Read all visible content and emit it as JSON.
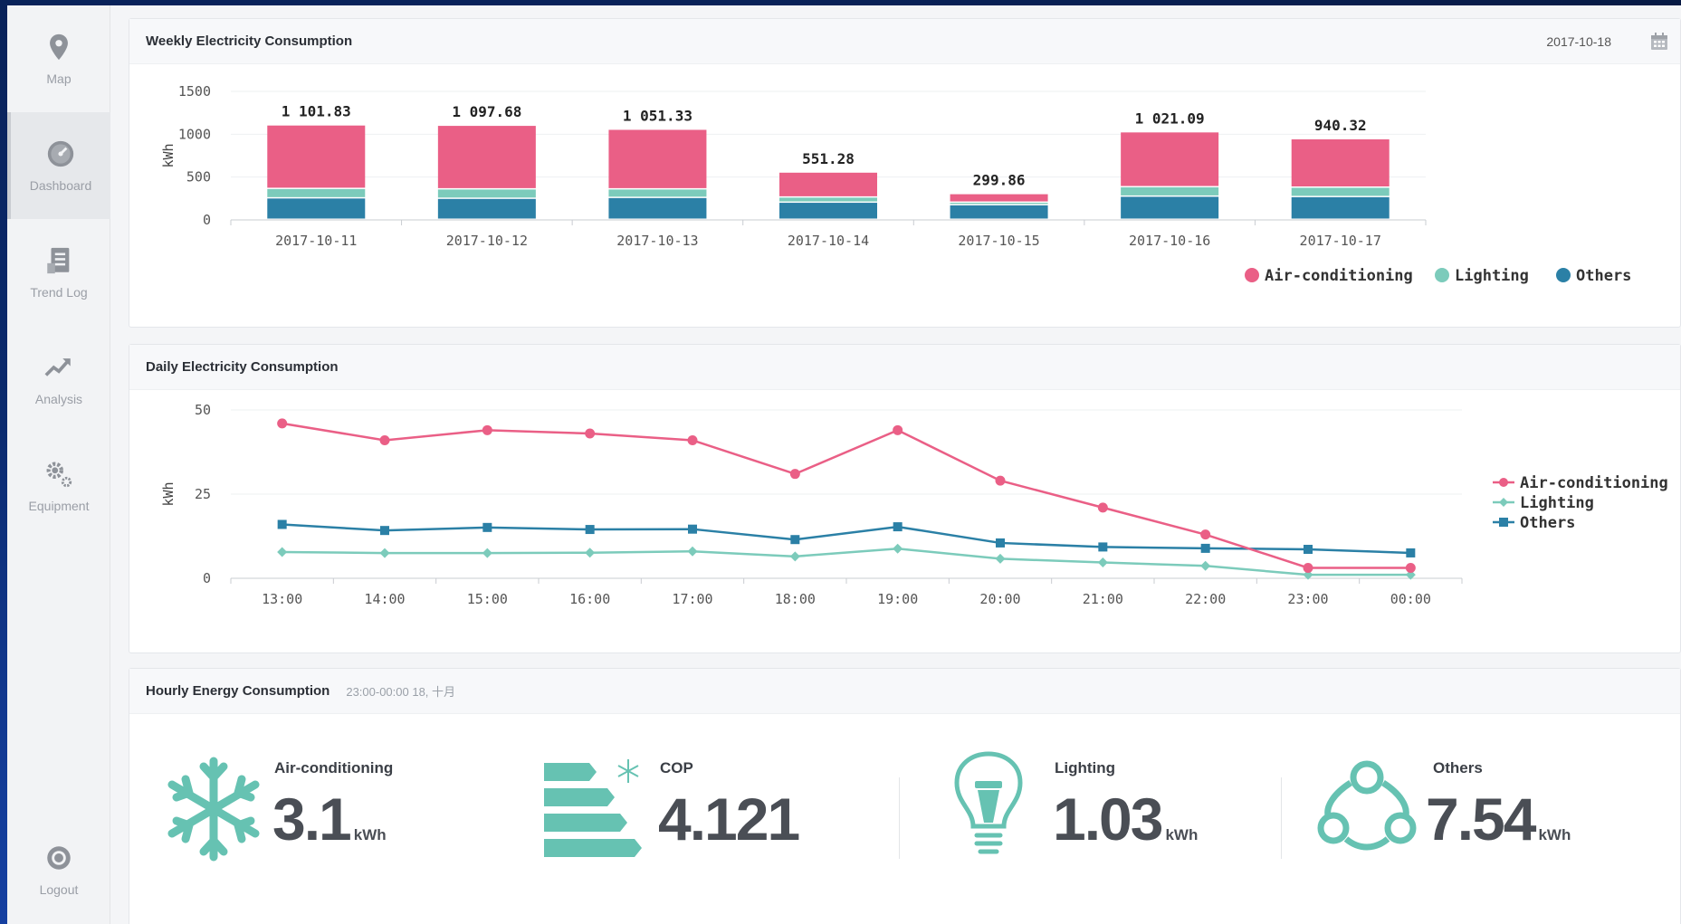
{
  "sidebar": {
    "items": [
      {
        "label": "Map",
        "icon": "map-pin-icon"
      },
      {
        "label": "Dashboard",
        "icon": "dashboard-gauge-icon"
      },
      {
        "label": "Trend Log",
        "icon": "trend-log-icon"
      },
      {
        "label": "Analysis",
        "icon": "analysis-trend-icon"
      },
      {
        "label": "Equipment",
        "icon": "gears-icon"
      },
      {
        "label": "Logout",
        "icon": "logout-icon"
      }
    ],
    "active": "Dashboard"
  },
  "weekly": {
    "title": "Weekly Electricity Consumption",
    "date": "2017-10-18",
    "icon": "calendar-icon"
  },
  "daily": {
    "title": "Daily Electricity Consumption"
  },
  "hourly": {
    "title": "Hourly Energy Consumption",
    "subtitle": "23:00-00:00 18, 十月",
    "stats": [
      {
        "label": "Air-conditioning",
        "value": "3.1",
        "unit": "kWh",
        "icon": "snowflake-icon"
      },
      {
        "label": "COP",
        "value": "4.121",
        "unit": "",
        "icon": "efficiency-bars-icon"
      },
      {
        "label": "Lighting",
        "value": "1.03",
        "unit": "kWh",
        "icon": "lightbulb-icon"
      },
      {
        "label": "Others",
        "value": "7.54",
        "unit": "kWh",
        "icon": "network-nodes-icon"
      }
    ]
  },
  "colors": {
    "air": "#ea5f86",
    "lighting": "#7ccbbb",
    "others": "#2b80a6",
    "accent": "#66c2b2"
  },
  "chart_data": [
    {
      "type": "bar",
      "title": "Weekly Electricity Consumption",
      "ylabel": "kWh",
      "ylim": [
        0,
        1500
      ],
      "yticks": [
        0,
        500,
        1000,
        1500
      ],
      "stacked": true,
      "categories": [
        "2017-10-11",
        "2017-10-12",
        "2017-10-13",
        "2017-10-14",
        "2017-10-15",
        "2017-10-16",
        "2017-10-17"
      ],
      "totals": [
        1101.83,
        1097.68,
        1051.33,
        551.28,
        299.86,
        1021.09,
        940.32
      ],
      "total_labels": [
        "1 101.83",
        "1 097.68",
        "1 051.33",
        "551.28",
        "299.86",
        "1 021.09",
        "940.32"
      ],
      "series": [
        {
          "name": "Others",
          "values": [
            250,
            245,
            255,
            200,
            170,
            270,
            265
          ]
        },
        {
          "name": "Lighting",
          "values": [
            110,
            110,
            100,
            60,
            30,
            110,
            110
          ]
        },
        {
          "name": "Air-conditioning",
          "values": [
            741.83,
            742.68,
            696.33,
            291.28,
            99.86,
            641.09,
            565.32
          ]
        }
      ],
      "legend": "bottom-right"
    },
    {
      "type": "line",
      "title": "Daily Electricity Consumption",
      "ylabel": "kWh",
      "ylim": [
        0,
        50
      ],
      "yticks": [
        0,
        25,
        50
      ],
      "x": [
        "13:00",
        "14:00",
        "15:00",
        "16:00",
        "17:00",
        "18:00",
        "19:00",
        "20:00",
        "21:00",
        "22:00",
        "23:00",
        "00:00"
      ],
      "series": [
        {
          "name": "Air-conditioning",
          "values": [
            46,
            41,
            44,
            43,
            41,
            31,
            44,
            29,
            21,
            13,
            3.1,
            3.1
          ]
        },
        {
          "name": "Lighting",
          "values": [
            7.8,
            7.5,
            7.5,
            7.6,
            8,
            6.5,
            8.8,
            5.8,
            4.7,
            3.7,
            1.03,
            1.03
          ]
        },
        {
          "name": "Others",
          "values": [
            16,
            14.2,
            15.1,
            14.5,
            14.6,
            11.5,
            15.3,
            10.5,
            9.3,
            8.9,
            8.6,
            7.54
          ]
        }
      ],
      "legend": "right"
    }
  ]
}
